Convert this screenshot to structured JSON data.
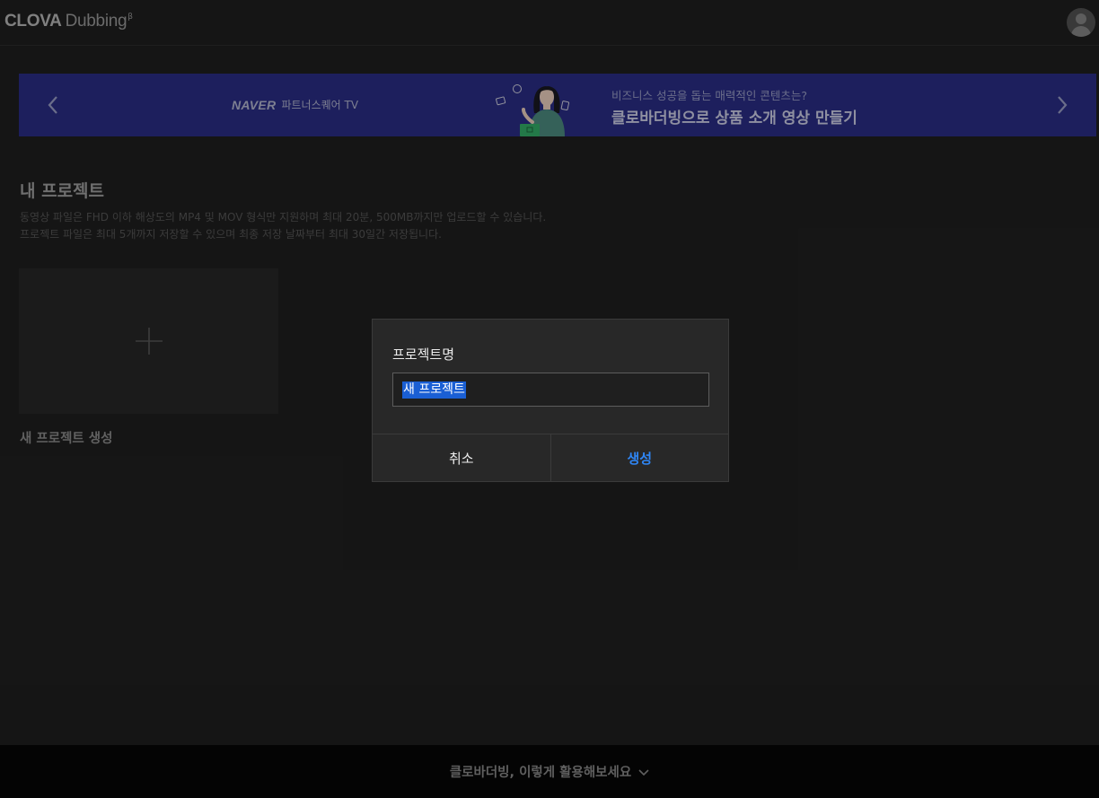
{
  "header": {
    "logo_strong": "CLOVA",
    "logo_light": "Dubbing",
    "logo_mark": "β"
  },
  "banner": {
    "brand_naver": "NAVER",
    "brand_tv": "파트너스퀘어 TV",
    "subtitle": "비즈니스 성공을 돕는 매력적인 콘텐츠는?",
    "title": "클로바더빙으로 상품 소개 영상 만들기",
    "bg_color": "#2b2f8a"
  },
  "section": {
    "title": "내 프로젝트",
    "desc1": "동영상 파일은 FHD 이하 해상도의 MP4 및 MOV 형식만 지원하며 최대 20분, 500MB까지만 업로드할 수 있습니다.",
    "desc2": "프로젝트 파일은 최대 5개까지 저장할 수 있으며 최종 저장 날짜부터 최대 30일간 저장됩니다.",
    "new_project_label": "새 프로젝트 생성"
  },
  "footer": {
    "label": "클로바더빙, 이렇게 활용해보세요"
  },
  "modal": {
    "label": "프로젝트명",
    "input_value": "새 프로젝트",
    "cancel_label": "취소",
    "create_label": "생성",
    "accent_color": "#2f86f5"
  }
}
